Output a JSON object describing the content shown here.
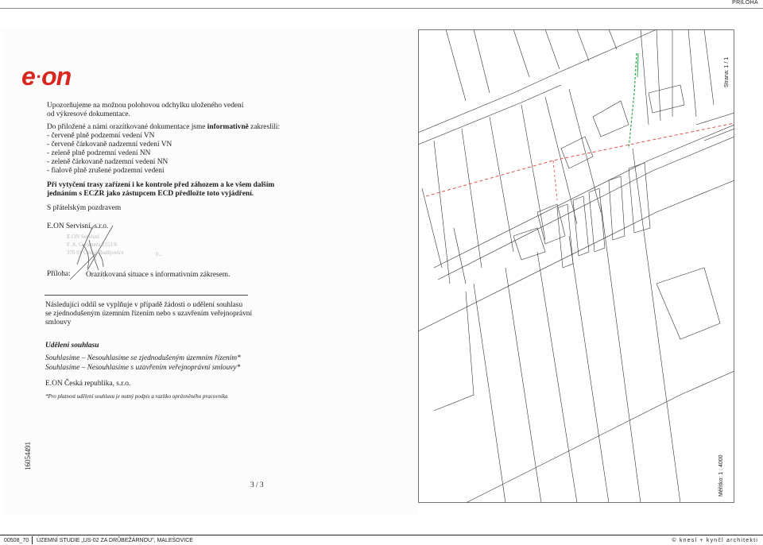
{
  "header": {
    "label": "PŘÍLOHA"
  },
  "letter": {
    "logo_text": "e·on",
    "intro": [
      "Upozorňujeme na možnou polohovou odchylku uloženého vedení",
      "od výkresové dokumentace."
    ],
    "drawn_lead_normal": "Do přiložené a námi orazítkované dokumentace jsme ",
    "drawn_lead_bold": "informativně",
    "drawn_lead_end": " zakreslili:",
    "legend": [
      "- červeně plně podzemní vedení VN",
      "- červeně čárkovaně nadzemní vedení VN",
      "- zeleně plně podzemní vedení NN",
      "- zeleně čárkovaně nadzemní vedení NN",
      "- fialově plně zrušené podzemní vedení"
    ],
    "notice": [
      "Při vytyčení trasy zařízení i ke kontrole před záhozem a ke všem dalším",
      "jednáním s ECZR jako zástupcem ECD předložte toto vyjádření."
    ],
    "greeting": "S přátelským pozdravem",
    "company": "E.ON Servisní, s.r.o.",
    "stamp": [
      "E.ON Servisní",
      "F. A. Gerstnera 2151/6",
      "370 01 České Budějovice",
      "0..."
    ],
    "attachment_label": "Příloha:",
    "attachment_text": "Orazítkovaná situace s informativním zákresem.",
    "section_note": [
      "Následující oddíl se vyplňuje v případě žádosti o udělení souhlasu",
      "se zjednodušeným územním řízením nebo s uzavřením veřejnoprávní",
      "smlouvy"
    ],
    "consent_title": "Udělení souhlasu",
    "consent_lines": [
      "Souhlasíme – Nesouhlasíme se zjednodušeným územním řízením*",
      "Souhlasíme – Nesouhlasíme s uzavřením veřejnoprávní smlouvy*"
    ],
    "consent_company": "E.ON Česká republika, s.r.o.",
    "footnote": "*Pro platnost udělení souhlasu je nutný podpis a razítko oprávněného pracovníka",
    "doc_number": "16054491",
    "page": "3 / 3"
  },
  "map": {
    "page_label": "Strana: 1 / 1",
    "scale_label": "Měřítko: 1 : 4000",
    "colors": {
      "vn_overhead": "#e0403a",
      "nn_underground": "#2aa84a",
      "parcel_line": "#333333"
    }
  },
  "footer": {
    "code": "00508_70",
    "title": "ÚZEMNÍ STUDIE „US-02 ZA DRŮBEŽÁRNOU\", MALEŠOVICE",
    "author": "© knesl + kynčl architekti"
  }
}
